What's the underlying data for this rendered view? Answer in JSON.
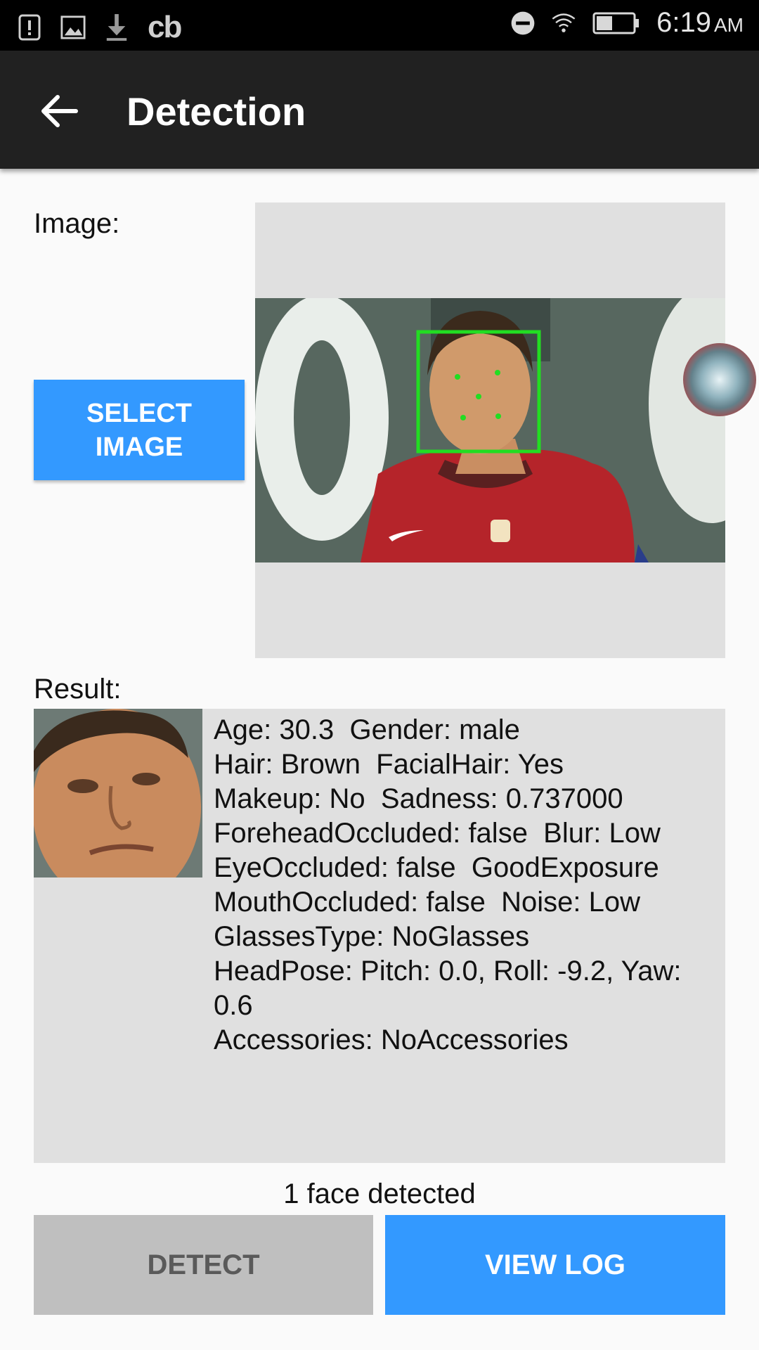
{
  "status_bar": {
    "time": "6:19",
    "ampm": "AM",
    "carrier_label": "cb",
    "icons": [
      "alert-icon",
      "image-icon",
      "download-icon",
      "do-not-disturb-icon",
      "wifi-icon",
      "battery-icon"
    ]
  },
  "app_bar": {
    "title": "Detection",
    "back_icon": "arrow-back-icon"
  },
  "image_section": {
    "label": "Image:",
    "select_button": "SELECT\nIMAGE"
  },
  "result_section": {
    "label": "Result:",
    "lines": [
      "Age: 30.3  Gender: male",
      "Hair: Brown  FacialHair: Yes",
      "Makeup: No  Sadness: 0.737000",
      "ForeheadOccluded: false  Blur: Low",
      "EyeOccluded: false  GoodExposure",
      "MouthOccluded: false  Noise: Low",
      "GlassesType: NoGlasses",
      "HeadPose: Pitch: 0.0, Roll: -9.2, Yaw: 0.6",
      "Accessories: NoAccessories"
    ]
  },
  "status_text": "1 face detected",
  "buttons": {
    "detect": "DETECT",
    "view_log": "VIEW LOG"
  },
  "colors": {
    "accent": "#3399ff",
    "disabled": "#bfbfbf",
    "app_bar": "#212121",
    "face_box": "#22dd22"
  }
}
